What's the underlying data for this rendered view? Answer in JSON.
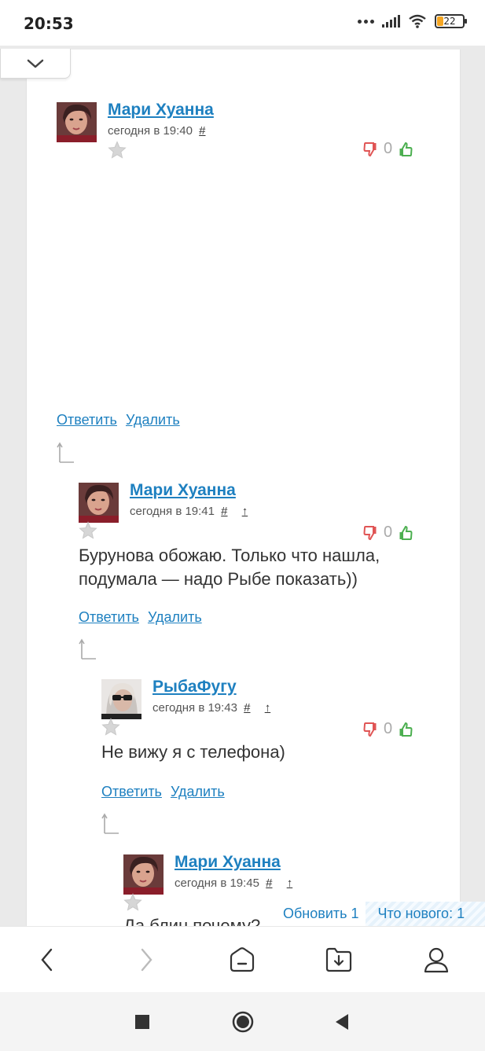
{
  "status_bar": {
    "time": "20:53",
    "battery": "22"
  },
  "comments": [
    {
      "author": "Мари Хуанна",
      "time": "сегодня в 19:40",
      "hash": "#",
      "up": "",
      "rating": "0",
      "text": "",
      "reply_label": "Ответить",
      "delete_label": "Удалить"
    },
    {
      "author": "Мари Хуанна",
      "time": "сегодня в 19:41",
      "hash": "#",
      "up": "↑",
      "rating": "0",
      "text_line1": "Бурунова обожаю. Только что нашла,",
      "text_line2": "подумала — надо Рыбе показать))",
      "reply_label": "Ответить",
      "delete_label": "Удалить"
    },
    {
      "author": "РыбаФугу",
      "time": "сегодня в 19:43",
      "hash": "#",
      "up": "↑",
      "rating": "0",
      "text": "Не вижу я с телефона)",
      "reply_label": "Ответить",
      "delete_label": "Удалить"
    },
    {
      "author": "Мари Хуанна",
      "time": "сегодня в 19:45",
      "hash": "#",
      "up": "↑",
      "text_partial": "Да блин почему?"
    }
  ],
  "refresh_bar": {
    "refresh_label": "Обновить 1",
    "new_label": "Что нового: 1"
  },
  "colors": {
    "link": "#1e80c0",
    "thumb_down": "#e05555",
    "thumb_up": "#4caf50"
  },
  "browser_bar": {
    "icons": [
      "back-icon",
      "forward-icon",
      "home-icon",
      "downloads-icon",
      "profile-icon"
    ]
  },
  "android_nav": {
    "icons": [
      "recents-icon",
      "home-circle-icon",
      "back-triangle-icon"
    ]
  }
}
